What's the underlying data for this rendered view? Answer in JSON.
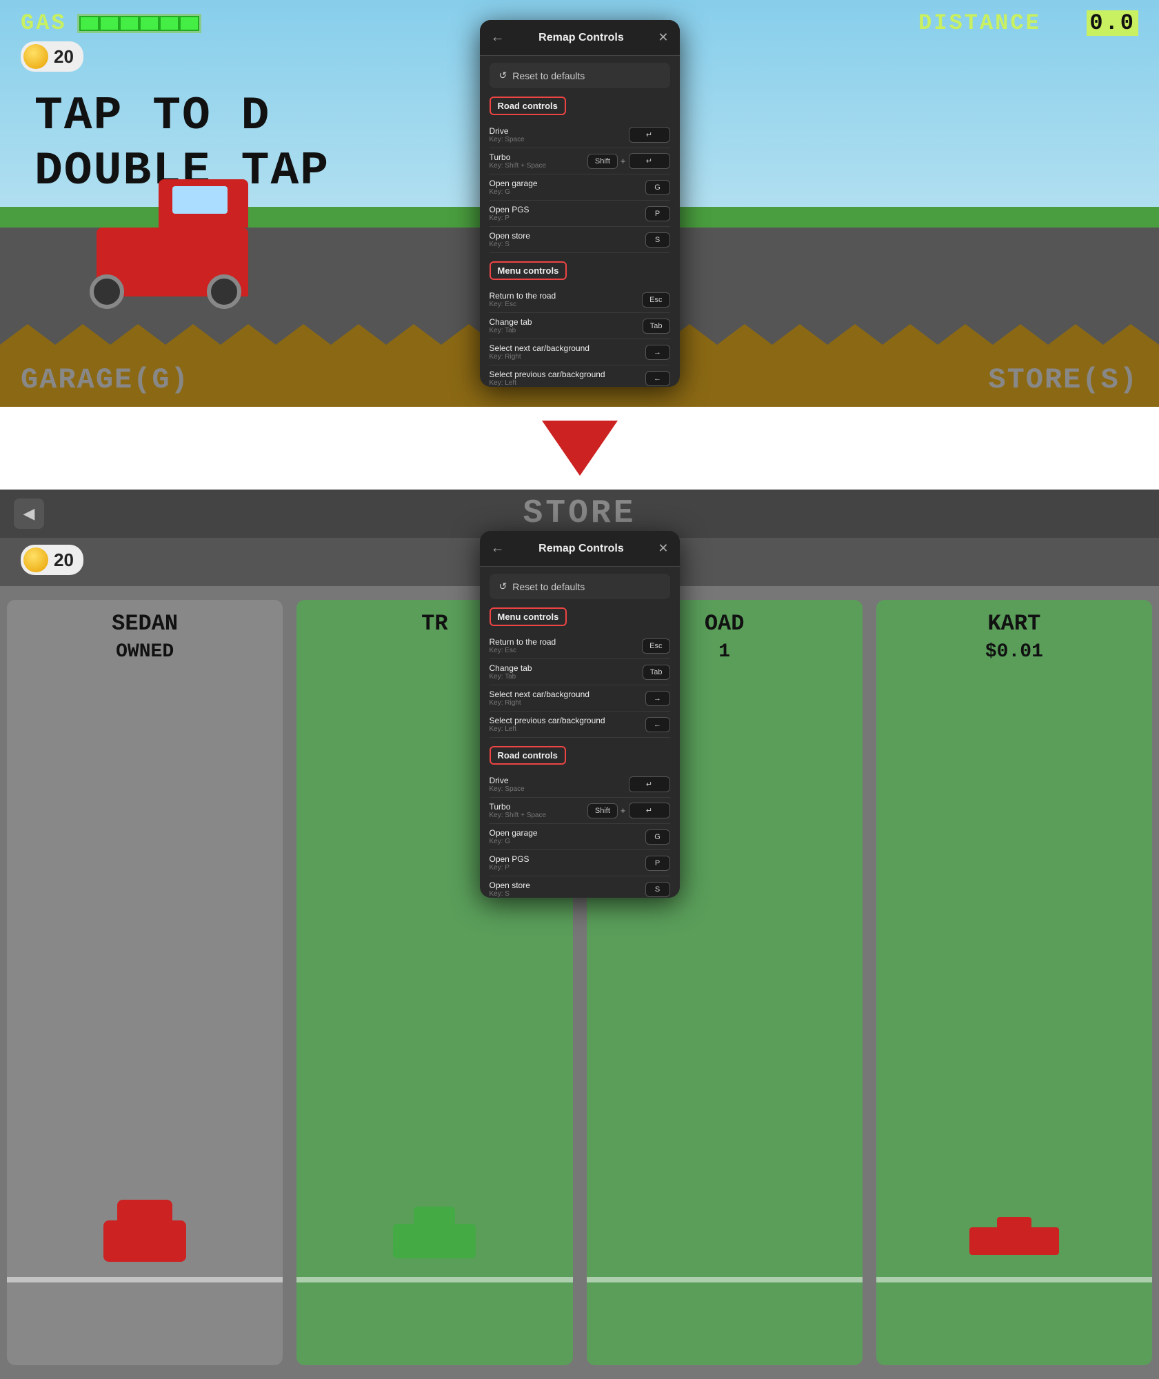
{
  "topScreen": {
    "gasLabel": "GAS",
    "distanceLabel": "DISTANCE",
    "distanceValue": "0.0",
    "coinCount": "20",
    "tapText": "TAP TO D",
    "doubleText": "DOUBLE TAP",
    "garageText": "GARAGE(G)",
    "storeText": "STORE(S)"
  },
  "bottomScreen": {
    "storeTitle": "STORE",
    "coinCount": "20",
    "card1Label": "SEDAN",
    "card1Sublabel": "OWNED",
    "card2Label": "TR",
    "card3Label": "OAD",
    "card3Price": "1",
    "card4Label": "KART",
    "card4Price": "$0.01"
  },
  "modal": {
    "title": "Remap Controls",
    "backLabel": "←",
    "closeLabel": "✕",
    "resetLabel": "Reset to defaults",
    "resetIcon": "↺",
    "sections": {
      "roadControls": {
        "label": "Road controls",
        "items": [
          {
            "name": "Drive",
            "keyHint": "Key: Space",
            "keys": [
              "↵"
            ],
            "combo": false
          },
          {
            "name": "Turbo",
            "keyHint": "Key: Shift + Space",
            "keys": [
              "Shift",
              "↵"
            ],
            "combo": true
          },
          {
            "name": "Open garage",
            "keyHint": "Key: G",
            "keys": [
              "G"
            ],
            "combo": false
          },
          {
            "name": "Open PGS",
            "keyHint": "Key: P",
            "keys": [
              "P"
            ],
            "combo": false
          },
          {
            "name": "Open store",
            "keyHint": "Key: S",
            "keys": [
              "S"
            ],
            "combo": false
          }
        ]
      },
      "menuControls": {
        "label": "Menu controls",
        "items": [
          {
            "name": "Return to the road",
            "keyHint": "Key: Esc",
            "keys": [
              "Esc"
            ],
            "combo": false
          },
          {
            "name": "Change tab",
            "keyHint": "Key: Tab",
            "keys": [
              "Tab"
            ],
            "combo": false
          },
          {
            "name": "Select next car/background",
            "keyHint": "Key: Right",
            "keys": [
              "→"
            ],
            "combo": false
          },
          {
            "name": "Select previous car/background",
            "keyHint": "Key: Left",
            "keys": [
              "←"
            ],
            "combo": false
          }
        ]
      }
    }
  },
  "modal2": {
    "title": "Remap Controls",
    "resetLabel": "Reset to defaults",
    "resetIcon": "↺",
    "sections": {
      "menuControls": {
        "label": "Menu controls",
        "items": [
          {
            "name": "Return to the road",
            "keyHint": "Key: Esc",
            "keys": [
              "Esc"
            ],
            "combo": false
          },
          {
            "name": "Change tab",
            "keyHint": "Key: Tab",
            "keys": [
              "Tab"
            ],
            "combo": false
          },
          {
            "name": "Select next car/background",
            "keyHint": "Key: Right",
            "keys": [
              "→"
            ],
            "combo": false
          },
          {
            "name": "Select previous car/background",
            "keyHint": "Key: Left",
            "keys": [
              "←"
            ],
            "combo": false
          }
        ]
      },
      "roadControls": {
        "label": "Road controls",
        "items": [
          {
            "name": "Drive",
            "keyHint": "Key: Space",
            "keys": [
              "↵"
            ],
            "combo": false
          },
          {
            "name": "Turbo",
            "keyHint": "Key: Shift + Space",
            "keys": [
              "Shift",
              "↵"
            ],
            "combo": true
          },
          {
            "name": "Open garage",
            "keyHint": "Key: G",
            "keys": [
              "G"
            ],
            "combo": false
          },
          {
            "name": "Open PGS",
            "keyHint": "Key: P",
            "keys": [
              "P"
            ],
            "combo": false
          },
          {
            "name": "Open store",
            "keyHint": "Key: S",
            "keys": [
              "S"
            ],
            "combo": false
          }
        ]
      }
    }
  },
  "arrow": {
    "label": "down-arrow"
  }
}
